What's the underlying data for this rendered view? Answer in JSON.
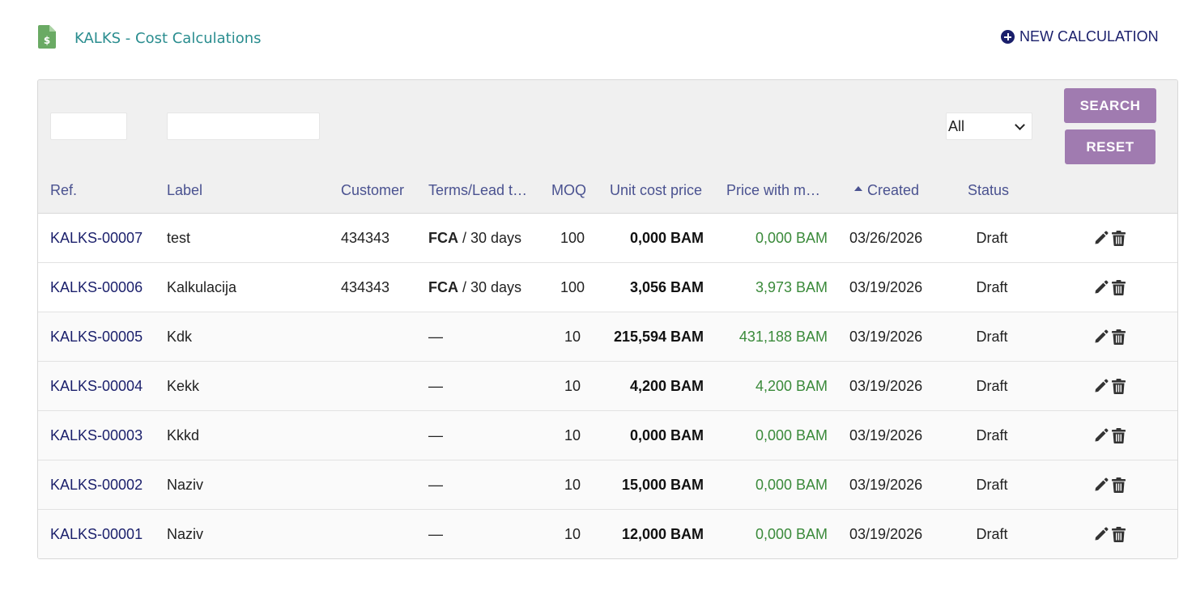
{
  "header": {
    "title": "KALKS - Cost Calculations",
    "new_button": "NEW CALCULATION"
  },
  "filters": {
    "ref_value": "",
    "label_value": "",
    "status_selected": "All",
    "search_label": "SEARCH",
    "reset_label": "RESET"
  },
  "columns": {
    "ref": "Ref.",
    "label": "Label",
    "customer": "Customer",
    "terms": "Terms/Lead t…",
    "moq": "MOQ",
    "unit_cost": "Unit cost price",
    "price_with": "Price with m…",
    "created": "Created",
    "status": "Status"
  },
  "colors": {
    "accent_purple": "#a07bb0",
    "link_navy": "#1a1f6b",
    "title_teal": "#2a8d8f",
    "price_green": "#3a8a3a"
  },
  "rows": [
    {
      "ref": "KALKS-00007",
      "label": "test",
      "customer": "434343",
      "incoterm": "FCA",
      "lead": " / 30 days",
      "moq": "100",
      "unit_cost": "0,000 BAM",
      "price": "0,000 BAM",
      "created": "03/26/2026",
      "status": "Draft"
    },
    {
      "ref": "KALKS-00006",
      "label": "Kalkulacija",
      "customer": "434343",
      "incoterm": "FCA",
      "lead": " / 30 days",
      "moq": "100",
      "unit_cost": "3,056 BAM",
      "price": "3,973 BAM",
      "created": "03/19/2026",
      "status": "Draft"
    },
    {
      "ref": "KALKS-00005",
      "label": "Kdk",
      "customer": "",
      "incoterm": "",
      "lead": "—",
      "moq": "10",
      "unit_cost": "215,594 BAM",
      "price": "431,188 BAM",
      "created": "03/19/2026",
      "status": "Draft"
    },
    {
      "ref": "KALKS-00004",
      "label": "Kekk",
      "customer": "",
      "incoterm": "",
      "lead": "—",
      "moq": "10",
      "unit_cost": "4,200 BAM",
      "price": "4,200 BAM",
      "created": "03/19/2026",
      "status": "Draft"
    },
    {
      "ref": "KALKS-00003",
      "label": "Kkkd",
      "customer": "",
      "incoterm": "",
      "lead": "—",
      "moq": "10",
      "unit_cost": "0,000 BAM",
      "price": "0,000 BAM",
      "created": "03/19/2026",
      "status": "Draft"
    },
    {
      "ref": "KALKS-00002",
      "label": "Naziv",
      "customer": "",
      "incoterm": "",
      "lead": "—",
      "moq": "10",
      "unit_cost": "15,000 BAM",
      "price": "0,000 BAM",
      "created": "03/19/2026",
      "status": "Draft"
    },
    {
      "ref": "KALKS-00001",
      "label": "Naziv",
      "customer": "",
      "incoterm": "",
      "lead": "—",
      "moq": "10",
      "unit_cost": "12,000 BAM",
      "price": "0,000 BAM",
      "created": "03/19/2026",
      "status": "Draft"
    }
  ]
}
